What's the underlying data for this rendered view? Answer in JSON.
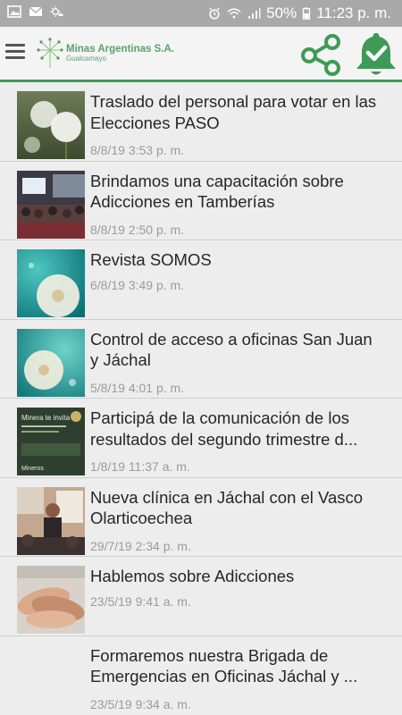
{
  "status_bar": {
    "battery": "50%",
    "time": "11:23 p. m."
  },
  "header": {
    "logo_name": "Minas Argentinas S.A.",
    "logo_sub": "Gualcamayo",
    "icons": [
      "menu-icon",
      "share-icon",
      "bell-check-icon"
    ],
    "accent_color": "#3e9a57"
  },
  "news": [
    {
      "title": "Traslado del personal para votar en las Elecciones PASO",
      "date": "8/8/19 3:53 p. m.",
      "thumb": "dandelion-icon"
    },
    {
      "title": "Brindamos una capacitación sobre Adicciones en Tamberías",
      "date": "8/8/19 2:50 p. m.",
      "thumb": "training-photo-icon"
    },
    {
      "title": "Revista SOMOS",
      "date": "6/8/19 3:49 p. m.",
      "thumb": "dandelion-teal-icon"
    },
    {
      "title": "Control de acceso a oficinas San Juan y Jáchal",
      "date": "5/8/19 4:01 p. m.",
      "thumb": "dandelion-teal-icon"
    },
    {
      "title": "Participá de la comunicación de los resultados del segundo trimestre d...",
      "date": "1/8/19 11:37 a. m.",
      "thumb": "invitation-flyer-icon"
    },
    {
      "title": "Nueva clínica en Jáchal con el Vasco Olarticoechea",
      "date": "29/7/19 2:34 p. m.",
      "thumb": "speaker-photo-icon"
    },
    {
      "title": "Hablemos sobre Adicciones",
      "date": "23/5/19 9:41 a. m.",
      "thumb": "hands-photo-icon"
    },
    {
      "title": "Formaremos nuestra Brigada de Emergencias en Oficinas Jáchal y ...",
      "date": "23/5/19 9:34 a. m.",
      "thumb": ""
    }
  ],
  "flyer": {
    "heading": "Minera te invita",
    "brand": "Mineros"
  }
}
